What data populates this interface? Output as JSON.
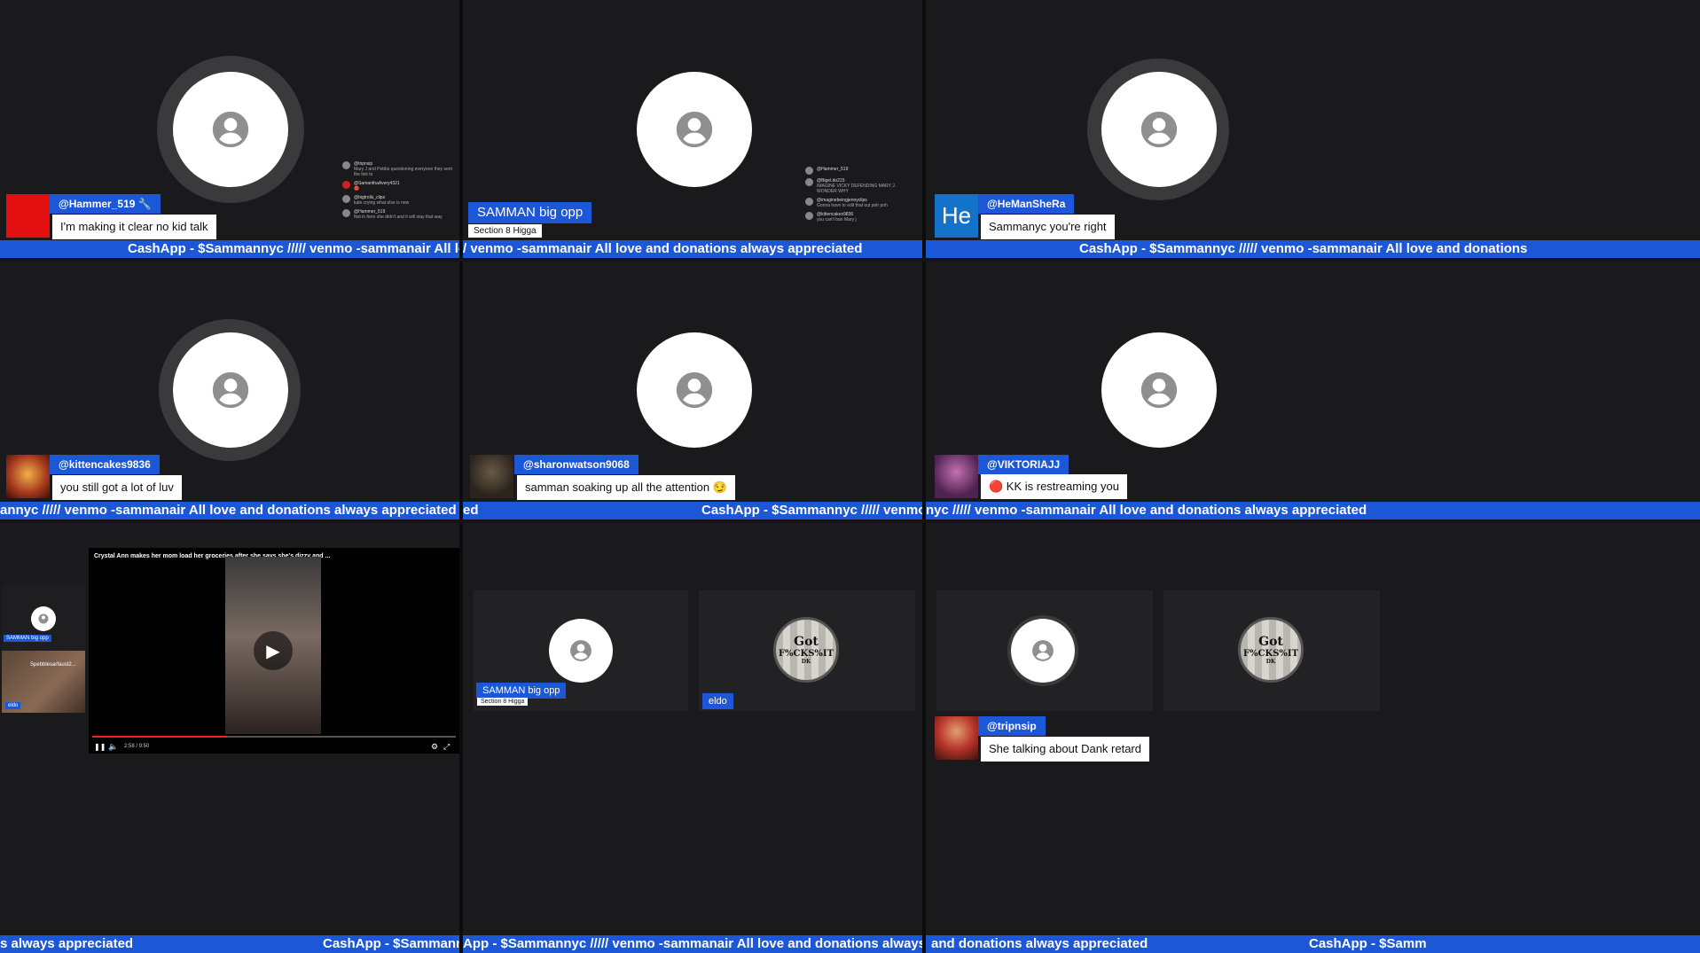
{
  "ticker_text": "CashApp - $Sammannyc ///// venmo -sammanair All love and donations always appreciated",
  "ticker_fragments": {
    "t1": "CashApp - $Sammannyc ///// venmo -sammanair All love and donations alwa",
    "t2": "/ venmo -sammanair All love and donations always appreciated",
    "t3": "CashApp - $Sammannyc ///// venmo -sammanair All love and donations",
    "t4": "annyc ///// venmo -sammanair All love and donations always appreciated",
    "t5a": "ed",
    "t5b": "CashApp - $Sammannyc ///// venmo -sammanair A",
    "t6": "nyc ///// venmo -sammanair All love and donations always appreciated",
    "t7a": "s always appreciated",
    "t7b": "CashApp - $Sammannyc ///// ve",
    "t8": "App - $Sammannyc ///// venmo -sammanair All love and donations always appreciated",
    "t9a": "and donations always appreciated",
    "t9b": "CashApp - $Samm"
  },
  "tiles": {
    "t1": {
      "user": "@Hammer_519 🔧",
      "message": "I'm making it clear no kid talk"
    },
    "t2": {
      "title": "SAMMAN big opp",
      "subtitle": "Section 8 Higga"
    },
    "t3": {
      "initials": "He",
      "user": "@HeManSheRa",
      "message": "Sammanyc you're right"
    },
    "t4": {
      "user": "@kittencakes9836",
      "message": "you still got a lot of luv"
    },
    "t5": {
      "user": "@sharonwatson9068",
      "message": "samman soaking up all the attention 😏"
    },
    "t6": {
      "user": "@VIKTORIAJJ",
      "message": "🔴 KK is restreaming you"
    },
    "t7": {
      "video_title": "Crystal Ann makes her mom load her groceries after she says she's dizzy and ...",
      "mini_tag": "SAMMAN big opp",
      "mini_user": "Spebblesarfaust2...",
      "mini_badge": "eldo",
      "time": "2:58 / 9:50"
    },
    "t8": {
      "title": "SAMMAN big opp",
      "subtitle": "Section 8 Higga",
      "tag": "eldo",
      "logo_top": "Got",
      "logo_bottom": "F%CKS%IT",
      "logo_small": "DK"
    },
    "t9": {
      "user": "@tripnsip",
      "message": "She talking about Dank retard",
      "logo_top": "Got",
      "logo_bottom": "F%CKS%IT",
      "logo_small": "DK"
    }
  },
  "chat1": [
    {
      "user": "@tripnsip",
      "text": "Mary J and Pebbs questioning everyone they sent the link to"
    },
    {
      "user": "@SamanthaAvery4321",
      "text": "🔴"
    },
    {
      "user": "@bigtrolls_clips",
      "text": "kate crying what else is new"
    },
    {
      "user": "@Hammer_519",
      "text": "Not in here she didn't and it will stay that way"
    }
  ],
  "chat2": [
    {
      "user": "@Hammer_519",
      "text": ""
    },
    {
      "user": "@Bigel.do215",
      "text": "IMAGINE VICKY DEFENDING MARY J. WONDER WHY"
    },
    {
      "user": "@imaginebeingjennyclips",
      "text": "Gonna have to edit that out poh poh"
    },
    {
      "user": "@kittencakes9836",
      "text": "you can't ban Mary j"
    }
  ],
  "colors": {
    "accent": "#1b57d6",
    "background": "#1a1a1c"
  },
  "icons": [
    "default-avatar-icon",
    "play-icon",
    "youtube-icon"
  ]
}
